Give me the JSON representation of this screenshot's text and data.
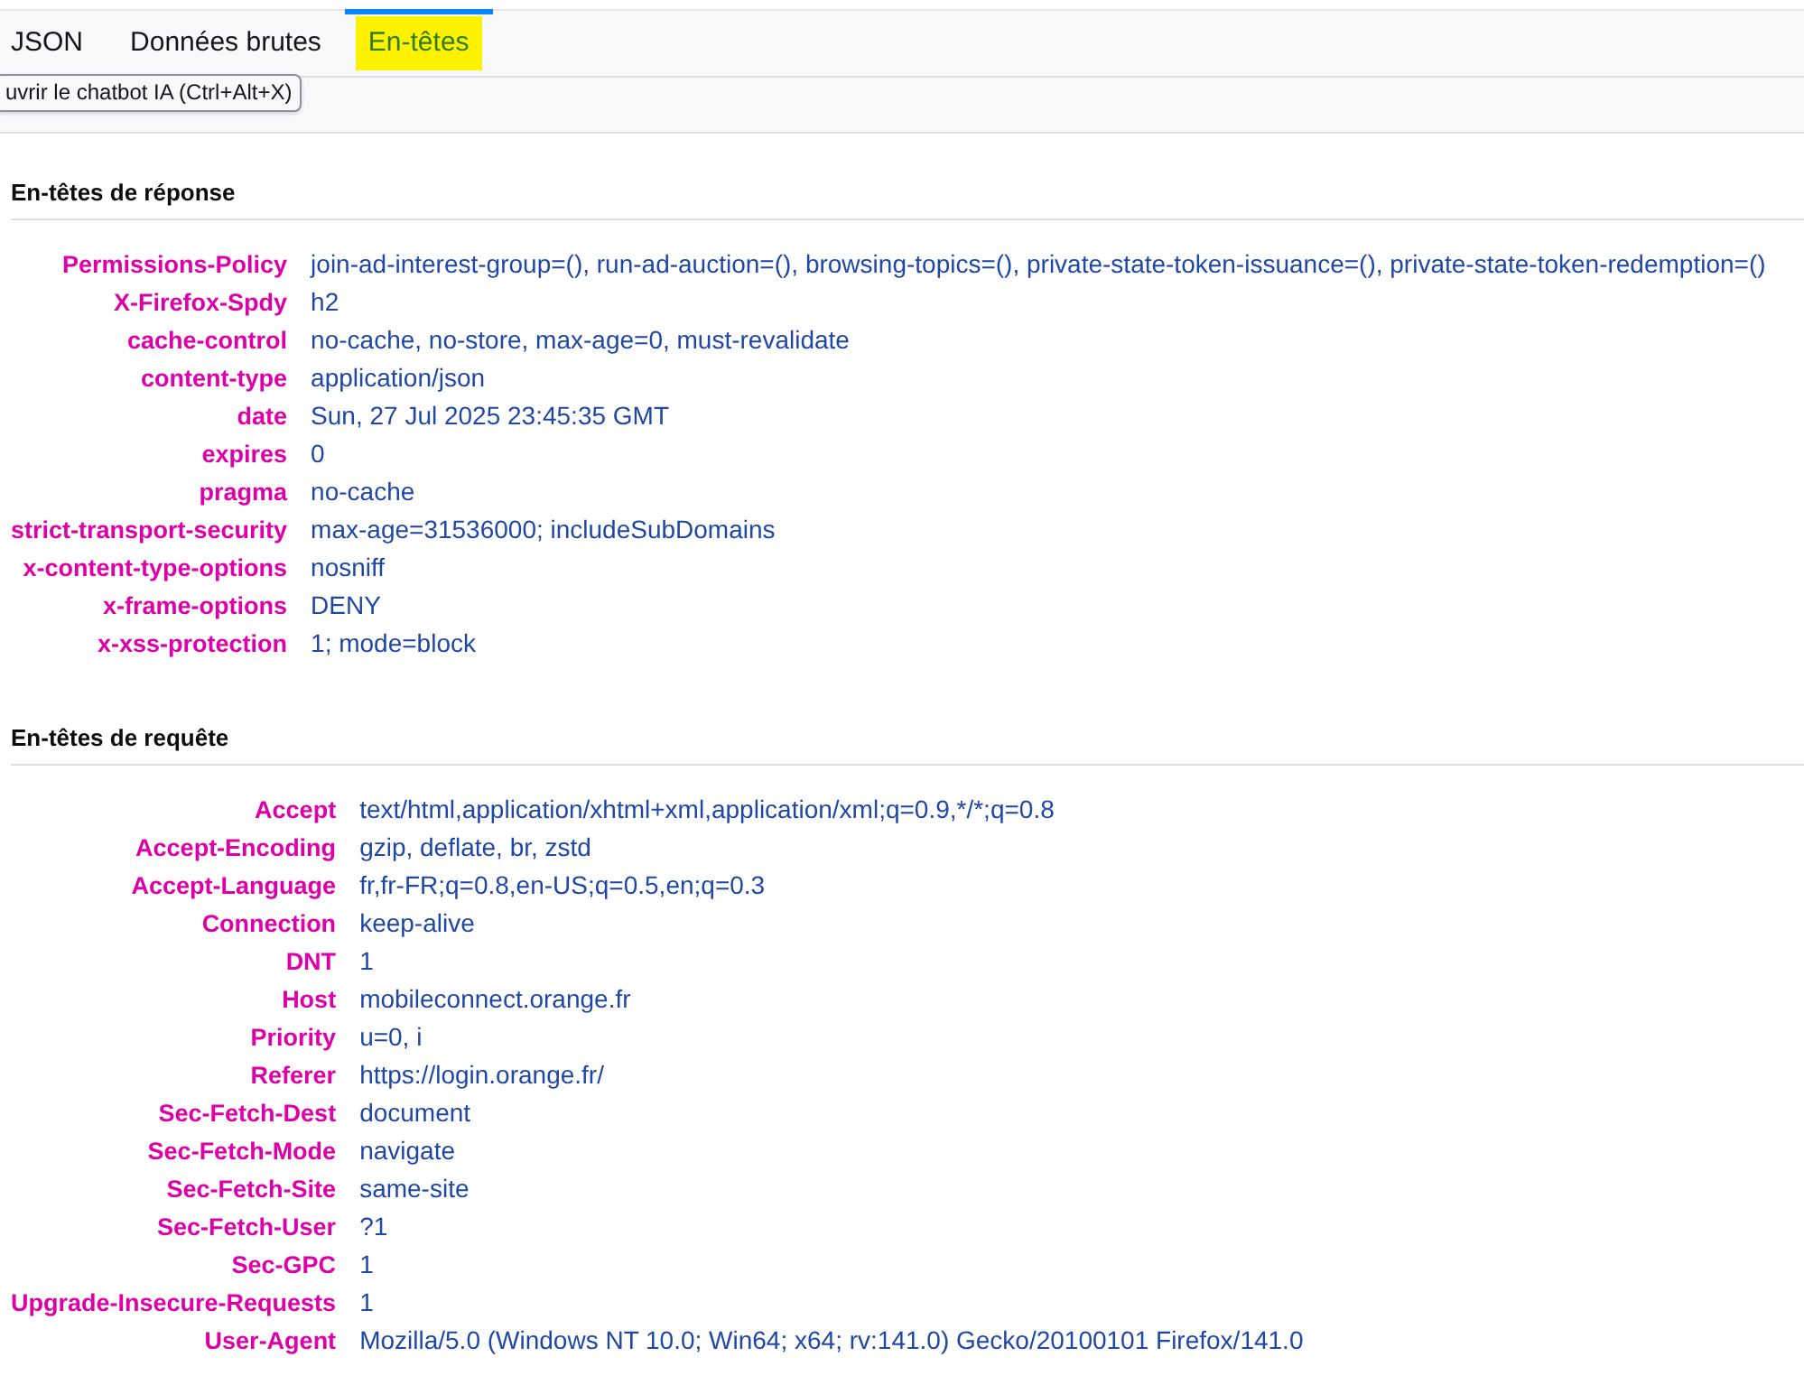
{
  "tabs": [
    {
      "label": "JSON",
      "selected": false,
      "highlighted": false
    },
    {
      "label": "Données brutes",
      "selected": false,
      "highlighted": false
    },
    {
      "label": "En-têtes",
      "selected": true,
      "highlighted": true
    }
  ],
  "tooltip": {
    "text": "uvrir le chatbot IA (Ctrl+Alt+X)"
  },
  "sections": [
    {
      "title": "En-têtes de réponse",
      "headers": [
        {
          "name": "Permissions-Policy",
          "value": "join-ad-interest-group=(), run-ad-auction=(), browsing-topics=(), private-state-token-issuance=(), private-state-token-redemption=()"
        },
        {
          "name": "X-Firefox-Spdy",
          "value": "h2"
        },
        {
          "name": "cache-control",
          "value": "no-cache, no-store, max-age=0, must-revalidate"
        },
        {
          "name": "content-type",
          "value": "application/json"
        },
        {
          "name": "date",
          "value": "Sun, 27 Jul 2025 23:45:35 GMT"
        },
        {
          "name": "expires",
          "value": "0"
        },
        {
          "name": "pragma",
          "value": "no-cache"
        },
        {
          "name": "strict-transport-security",
          "value": "max-age=31536000; includeSubDomains"
        },
        {
          "name": "x-content-type-options",
          "value": "nosniff"
        },
        {
          "name": "x-frame-options",
          "value": "DENY"
        },
        {
          "name": "x-xss-protection",
          "value": "1; mode=block"
        }
      ]
    },
    {
      "title": "En-têtes de requête",
      "headers": [
        {
          "name": "Accept",
          "value": "text/html,application/xhtml+xml,application/xml;q=0.9,*/*;q=0.8"
        },
        {
          "name": "Accept-Encoding",
          "value": "gzip, deflate, br, zstd"
        },
        {
          "name": "Accept-Language",
          "value": "fr,fr-FR;q=0.8,en-US;q=0.5,en;q=0.3"
        },
        {
          "name": "Connection",
          "value": "keep-alive"
        },
        {
          "name": "DNT",
          "value": "1"
        },
        {
          "name": "Host",
          "value": "mobileconnect.orange.fr"
        },
        {
          "name": "Priority",
          "value": "u=0, i"
        },
        {
          "name": "Referer",
          "value": "https://login.orange.fr/"
        },
        {
          "name": "Sec-Fetch-Dest",
          "value": "document"
        },
        {
          "name": "Sec-Fetch-Mode",
          "value": "navigate"
        },
        {
          "name": "Sec-Fetch-Site",
          "value": "same-site"
        },
        {
          "name": "Sec-Fetch-User",
          "value": "?1"
        },
        {
          "name": "Sec-GPC",
          "value": "1"
        },
        {
          "name": "Upgrade-Insecure-Requests",
          "value": "1"
        },
        {
          "name": "User-Agent",
          "value": "Mozilla/5.0 (Windows NT 10.0; Win64; x64; rv:141.0) Gecko/20100101 Firefox/141.0"
        }
      ]
    }
  ]
}
